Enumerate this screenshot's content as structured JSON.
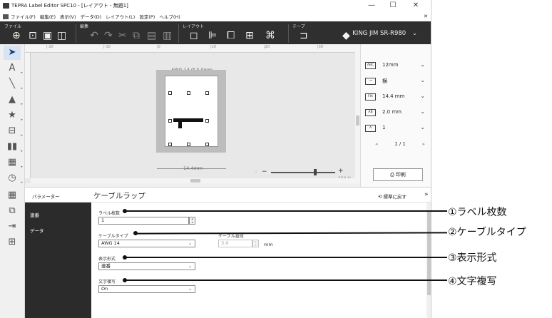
{
  "window": {
    "title": "TEPRA Label Editor SPC10 - [レイアウト - 無題1]",
    "controls": {
      "minimize": "—",
      "maximize": "☐",
      "close": "✕"
    },
    "doc_close": "✕"
  },
  "menu": [
    "ファイル(F)",
    "編集(E)",
    "表示(V)",
    "データ(D)",
    "レイアウト(L)",
    "設定(P)",
    "ヘルプ(H)"
  ],
  "ribbon": {
    "groups": [
      "ファイル",
      "編集",
      "レイアウト",
      "テープ"
    ],
    "printer": "KING JIM SR-R980",
    "printer_chevron": "⌄"
  },
  "canvas": {
    "ruler_ticks": [
      "|-20",
      "|-10",
      "|0",
      "|10",
      "|20",
      "|30"
    ],
    "dimension_top": "AWG 14 Ø 3.0mm",
    "dimension_bottom": "14.4mm",
    "zoom": "359 %",
    "zoom_minus": "−",
    "zoom_plus": "+"
  },
  "right_panel": {
    "rows": [
      {
        "icon": "ABC",
        "value": "12mm"
      },
      {
        "icon": "→",
        "value": "横"
      },
      {
        "icon": "FIX",
        "value": "14.4 mm"
      },
      {
        "icon": "AB",
        "value": "2.0 mm"
      },
      {
        "icon": "A",
        "value": "1"
      }
    ],
    "page": "1 / 1",
    "page_prev": "◂",
    "page_next": "▸",
    "chevron": "⌄",
    "print_label": "印刷"
  },
  "parameters": {
    "panel_label": "パラメーター",
    "title": "ケーブルラップ",
    "reset_label": "標準に戻す",
    "collapse": "»",
    "nav": [
      "連番",
      "データ"
    ],
    "fields": {
      "label_count_label": "ラベル枚数",
      "label_count_value": "1",
      "cable_type_label": "ケーブルタイプ",
      "cable_type_value": "AWG 14",
      "cable_diameter_label": "ケーブル直径",
      "cable_diameter_value": "3.0",
      "cable_diameter_unit": "mm",
      "display_format_label": "表示形式",
      "display_format_value": "連番",
      "text_copy_label": "文字複写",
      "text_copy_value": "On"
    }
  },
  "callouts": [
    "①ラベル枚数",
    "②ケーブルタイプ",
    "③表示形式",
    "④文字複写"
  ]
}
